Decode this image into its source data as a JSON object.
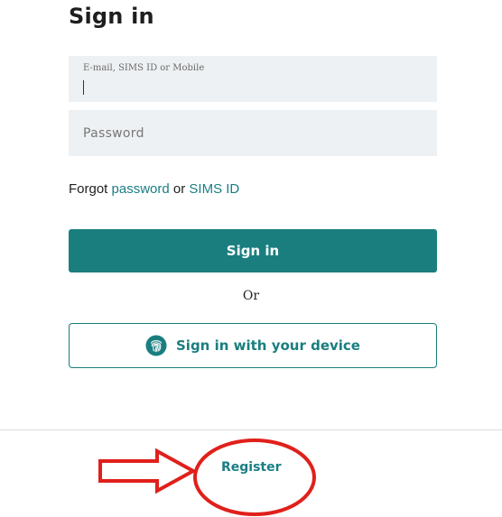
{
  "page": {
    "title": "Sign in"
  },
  "form": {
    "email": {
      "label": "E-mail, SIMS ID or Mobile",
      "value": ""
    },
    "password": {
      "placeholder": "Password",
      "value": ""
    }
  },
  "forgot": {
    "prefix": "Forgot",
    "password_link": "password",
    "or": "or",
    "sims_link": "SIMS ID"
  },
  "actions": {
    "signin_label": "Sign in",
    "or_label": "Or",
    "device_label": "Sign in with your device",
    "device_icon": "fingerprint-icon"
  },
  "footer": {
    "register_label": "Register"
  },
  "annotation": {
    "arrow_icon": "right-arrow-outline",
    "highlight": "circle-around-register",
    "color": "#e0201b"
  },
  "colors": {
    "accent": "#1a7e7f",
    "link": "#1a7e84",
    "field_bg": "#eef1f3"
  }
}
